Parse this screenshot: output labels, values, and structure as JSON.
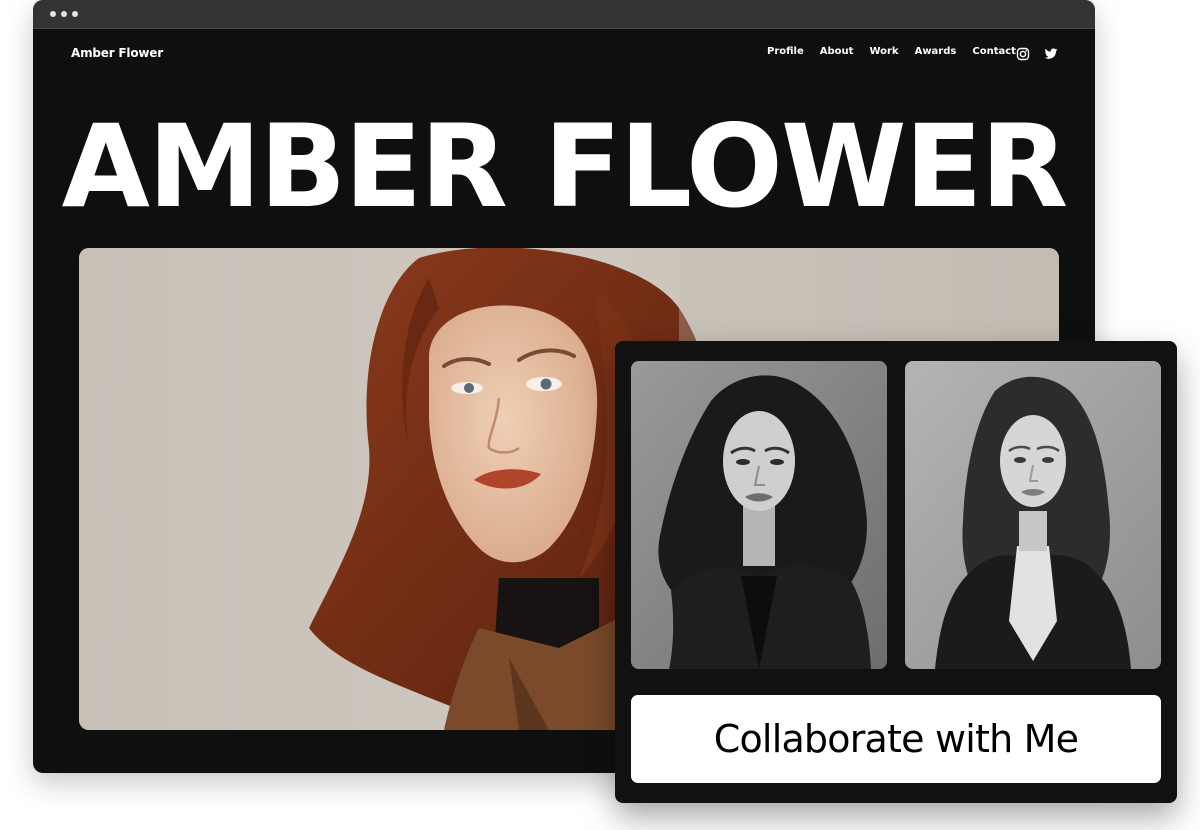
{
  "site": {
    "brand": "Amber Flower",
    "nav": [
      "Profile",
      "About",
      "Work",
      "Awards",
      "Contact"
    ],
    "social": [
      "instagram-icon",
      "twitter-icon"
    ]
  },
  "hero": {
    "title": "AMBER FLOWER"
  },
  "card": {
    "cta_label": "Collaborate with Me"
  },
  "colors": {
    "page_bg": "#0f0f0f",
    "titlebar": "#333333",
    "text": "#ffffff",
    "cta_bg": "#ffffff",
    "cta_text": "#000000",
    "hair": "#7a3219",
    "coat": "#7a4a2a",
    "lips": "#b0452c",
    "photo_bg": "#c9c2b9"
  }
}
